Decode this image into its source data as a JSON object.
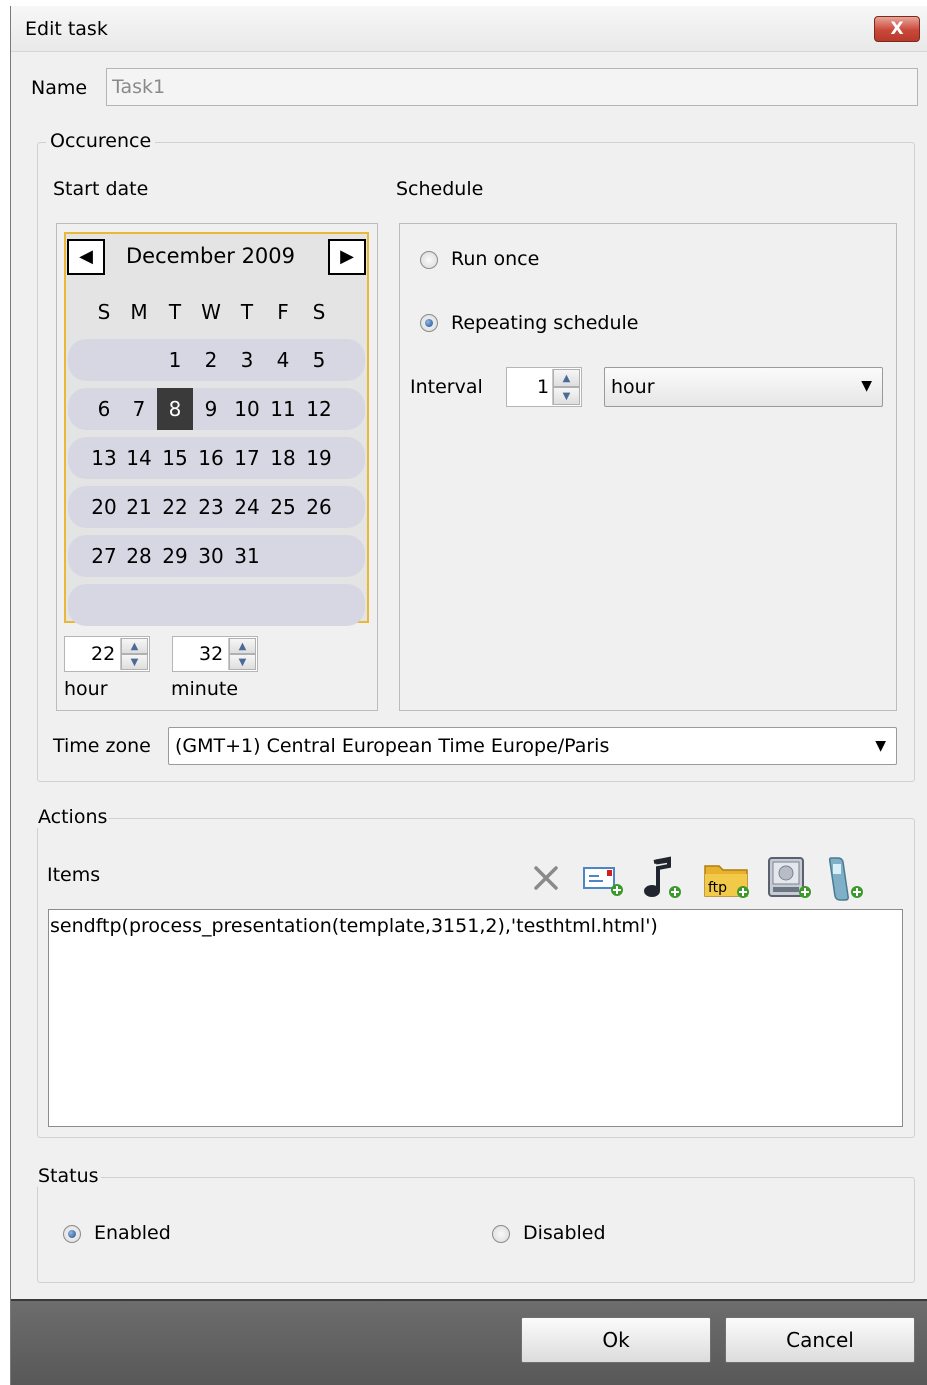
{
  "window": {
    "title": "Edit task",
    "close_label": "X"
  },
  "name_field": {
    "label": "Name",
    "value": "Task1"
  },
  "occurrence": {
    "legend": "Occurence",
    "start_date_label": "Start date",
    "schedule_label": "Schedule",
    "calendar": {
      "month_year": "December 2009",
      "prev": "◀",
      "next": "▶",
      "weekdays": [
        "S",
        "M",
        "T",
        "W",
        "T",
        "F",
        "S"
      ],
      "weeks": [
        [
          "",
          "",
          "1",
          "2",
          "3",
          "4",
          "5"
        ],
        [
          "6",
          "7",
          "8",
          "9",
          "10",
          "11",
          "12"
        ],
        [
          "13",
          "14",
          "15",
          "16",
          "17",
          "18",
          "19"
        ],
        [
          "20",
          "21",
          "22",
          "23",
          "24",
          "25",
          "26"
        ],
        [
          "27",
          "28",
          "29",
          "30",
          "31",
          "",
          ""
        ],
        [
          "",
          "",
          "",
          "",
          "",
          "",
          ""
        ]
      ],
      "selected_day": "8"
    },
    "hour": {
      "value": "22",
      "label": "hour"
    },
    "minute": {
      "value": "32",
      "label": "minute"
    },
    "run_once_label": "Run once",
    "repeating_label": "Repeating schedule",
    "selected_schedule": "repeating",
    "interval": {
      "label": "Interval",
      "value": "1",
      "unit": "hour"
    },
    "timezone": {
      "label": "Time zone",
      "value": "(GMT+1) Central European Time Europe/Paris"
    }
  },
  "actions": {
    "legend": "Actions",
    "items_label": "Items",
    "toolbar_icons": [
      "delete-icon",
      "add-email-icon",
      "add-sound-icon",
      "add-ftp-icon",
      "add-disk-icon",
      "add-sms-icon"
    ],
    "items_text": "sendftp(process_presentation(template,3151,2),'testhtml.html')"
  },
  "status": {
    "legend": "Status",
    "enabled_label": "Enabled",
    "disabled_label": "Disabled",
    "selected": "enabled"
  },
  "buttons": {
    "ok": "Ok",
    "cancel": "Cancel"
  },
  "colors": {
    "calendar_border": "#e8b838",
    "week_band": "#d7d7e4",
    "bottom_bar": "#5f5f5f",
    "selected_day_bg": "#3a3a3a"
  }
}
